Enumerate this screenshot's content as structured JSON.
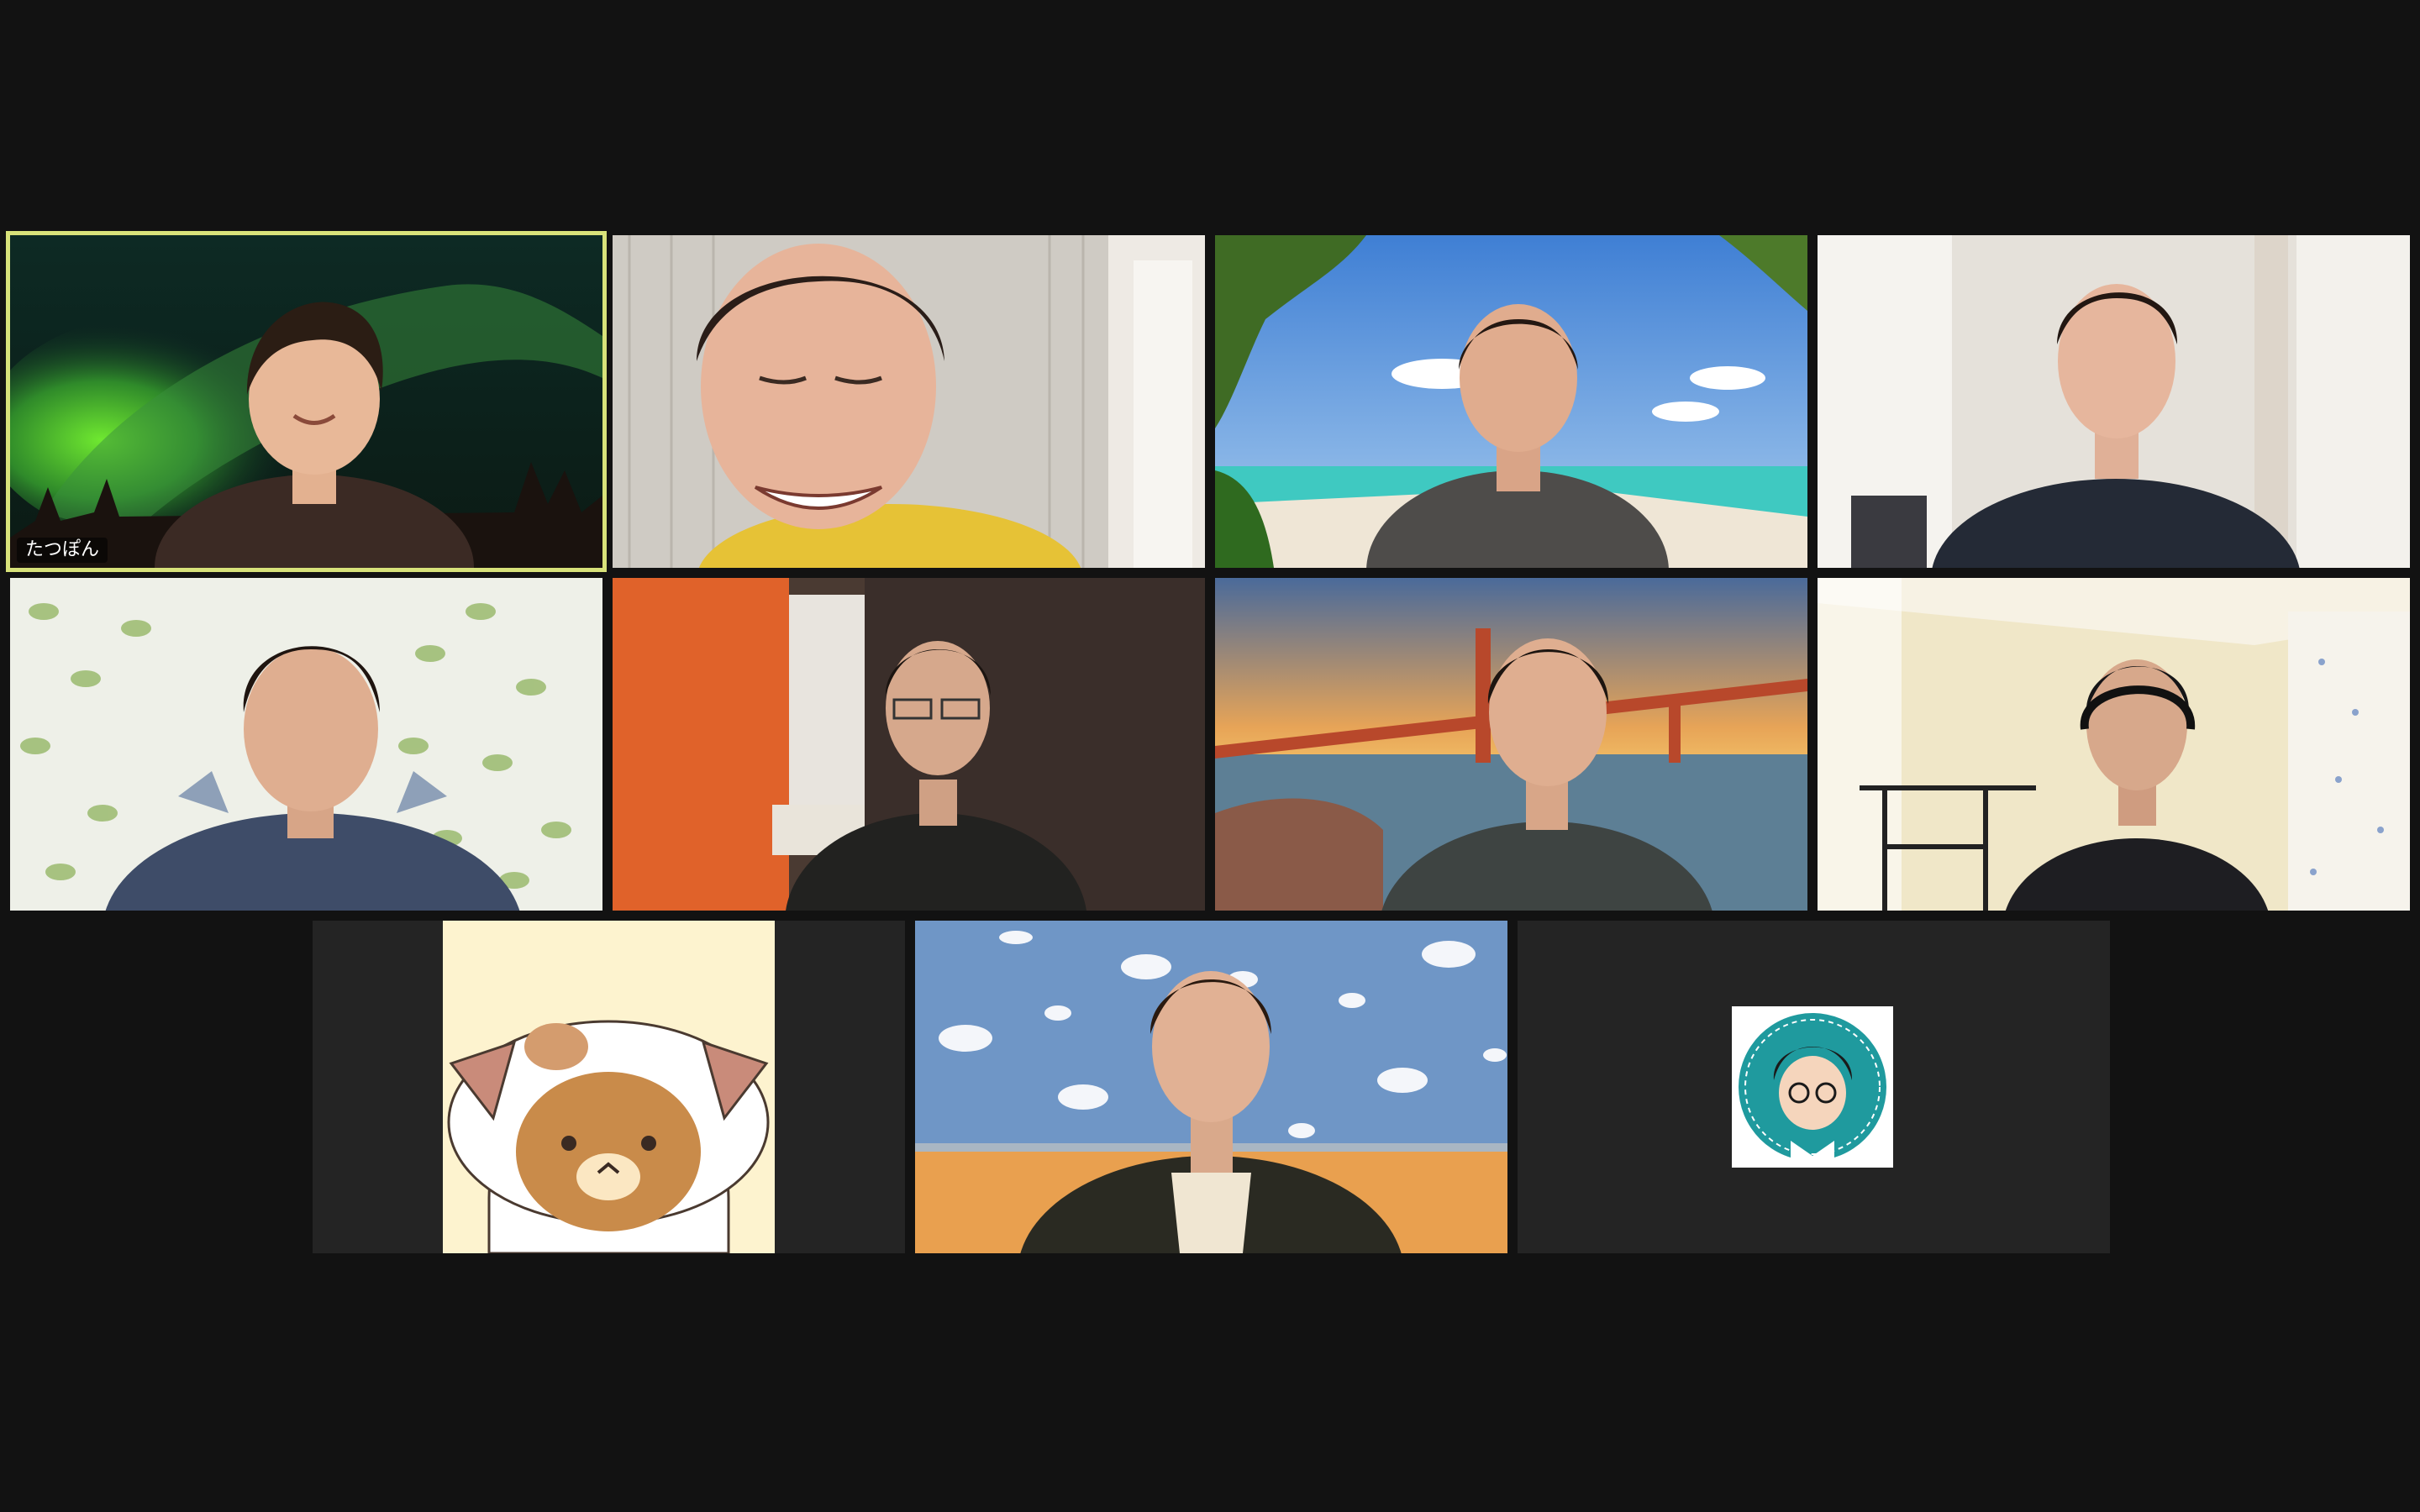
{
  "app": {
    "view": "gallery"
  },
  "participants": [
    {
      "display_name": "たつぽん",
      "background": "aurora",
      "active_speaker": true,
      "video": "on"
    },
    {
      "display_name": "",
      "background": "room-white-wall",
      "video": "on"
    },
    {
      "display_name": "",
      "background": "tropical-beach",
      "video": "on"
    },
    {
      "display_name": "",
      "background": "room-curtains",
      "video": "on"
    },
    {
      "display_name": "",
      "background": "leaf-curtains",
      "video": "on"
    },
    {
      "display_name": "",
      "background": "room-orange-curtain",
      "video": "on"
    },
    {
      "display_name": "",
      "background": "golden-gate-sunset",
      "video": "on"
    },
    {
      "display_name": "",
      "background": "room-exercise-bar",
      "video": "on"
    },
    {
      "display_name": "",
      "background": "cat-bear-avatar",
      "video": "off"
    },
    {
      "display_name": "",
      "background": "cloud-wallpaper",
      "video": "on"
    },
    {
      "display_name": "",
      "background": "teal-badge-avatar",
      "video": "off"
    }
  ],
  "colors": {
    "window_bg": "#121212",
    "tile_bg": "#2a2a2a",
    "active_border": "#d8e27a"
  }
}
